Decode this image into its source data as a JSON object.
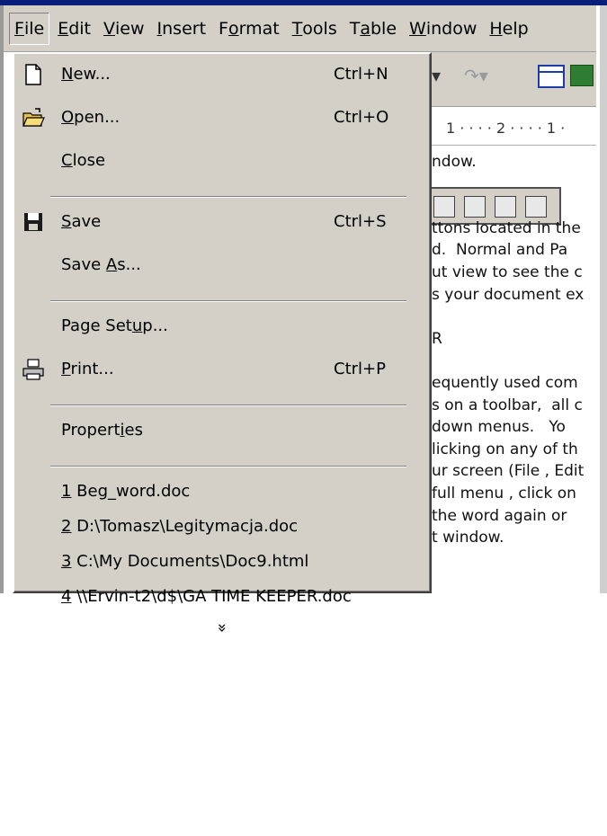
{
  "menubar": {
    "items": [
      {
        "label": "File",
        "accel": 0
      },
      {
        "label": "Edit",
        "accel": 0
      },
      {
        "label": "View",
        "accel": 0
      },
      {
        "label": "Insert",
        "accel": 0
      },
      {
        "label": "Format",
        "accel": 1
      },
      {
        "label": "Tools",
        "accel": 0
      },
      {
        "label": "Table",
        "accel": 1
      },
      {
        "label": "Window",
        "accel": 0
      },
      {
        "label": "Help",
        "accel": 0
      }
    ]
  },
  "file_menu": {
    "items": [
      {
        "type": "item",
        "label": "New...",
        "accel": 0,
        "shortcut": "Ctrl+N",
        "icon": "new-document-icon"
      },
      {
        "type": "item",
        "label": "Open...",
        "accel": 0,
        "shortcut": "Ctrl+O",
        "icon": "open-folder-icon"
      },
      {
        "type": "item",
        "label": "Close",
        "accel": 0,
        "shortcut": "",
        "icon": ""
      },
      {
        "type": "separator"
      },
      {
        "type": "item",
        "label": "Save",
        "accel": 0,
        "shortcut": "Ctrl+S",
        "icon": "save-disk-icon"
      },
      {
        "type": "item",
        "label": "Save As...",
        "accel": 5,
        "shortcut": "",
        "icon": ""
      },
      {
        "type": "separator"
      },
      {
        "type": "item",
        "label": "Page Setup...",
        "accel": 8,
        "shortcut": "",
        "icon": ""
      },
      {
        "type": "item",
        "label": "Print...",
        "accel": 0,
        "shortcut": "Ctrl+P",
        "icon": "printer-icon"
      },
      {
        "type": "separator"
      },
      {
        "type": "item",
        "label": "Properties",
        "accel": 7,
        "shortcut": "",
        "icon": ""
      },
      {
        "type": "separator"
      },
      {
        "type": "recent",
        "label": "1 Beg_word.doc",
        "accel": 0
      },
      {
        "type": "recent",
        "label": "2 D:\\Tomasz\\Legitymacja.doc",
        "accel": 0
      },
      {
        "type": "recent",
        "label": "3 C:\\My Documents\\Doc9.html",
        "accel": 0
      },
      {
        "type": "recent",
        "label": "4 \\\\Ervin-t2\\d$\\GA TIME KEEPER.doc",
        "accel": 0
      },
      {
        "type": "expand",
        "label": "»"
      }
    ]
  },
  "document": {
    "ruler": "1 · · · · 2 · · · · 1 ·",
    "lines": [
      "ndow.",
      "",
      "",
      "ttons located in the",
      "d.  Normal and Pa",
      "ut view to see the c",
      "s your document ex",
      "",
      "R",
      "",
      "equently used com",
      "s on a toolbar,  all c",
      "down menus.   Yo",
      "licking on any of th",
      "ur screen (File , Edit",
      "full menu , click on",
      "the word again or",
      "t window."
    ]
  },
  "colors": {
    "face": "#d4d0c8",
    "title": "#0a1f7a"
  }
}
